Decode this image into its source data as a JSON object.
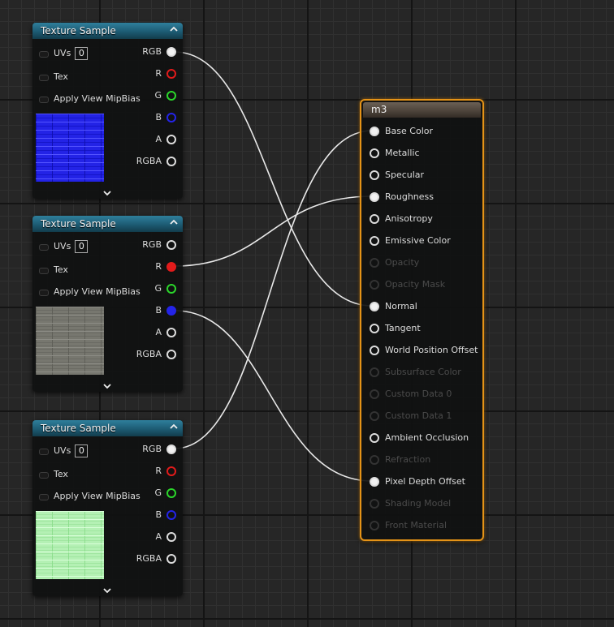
{
  "texture_nodes": [
    {
      "title": "Texture Sample",
      "inputs": {
        "uvs_label": "UVs",
        "uvs_value": "0",
        "tex_label": "Tex",
        "mip_label": "Apply View MipBias"
      },
      "outputs": [
        "RGB",
        "R",
        "G",
        "B",
        "A",
        "RGBA"
      ],
      "connected_output": "RGB",
      "preview": "blue-brick-normal-map"
    },
    {
      "title": "Texture Sample",
      "inputs": {
        "uvs_label": "UVs",
        "uvs_value": "0",
        "tex_label": "Tex",
        "mip_label": "Apply View MipBias"
      },
      "outputs": [
        "RGB",
        "R",
        "G",
        "B",
        "A",
        "RGBA"
      ],
      "connected_outputs": [
        "R",
        "B"
      ],
      "preview": "gray-brick-texture"
    },
    {
      "title": "Texture Sample",
      "inputs": {
        "uvs_label": "UVs",
        "uvs_value": "0",
        "tex_label": "Tex",
        "mip_label": "Apply View MipBias"
      },
      "outputs": [
        "RGB",
        "R",
        "G",
        "B",
        "A",
        "RGBA"
      ],
      "connected_output": "RGB",
      "preview": "green-brick-texture"
    }
  ],
  "material_node": {
    "title": "m3",
    "pins": [
      {
        "label": "Base Color",
        "enabled": true,
        "connected": true
      },
      {
        "label": "Metallic",
        "enabled": true,
        "connected": false
      },
      {
        "label": "Specular",
        "enabled": true,
        "connected": false
      },
      {
        "label": "Roughness",
        "enabled": true,
        "connected": true
      },
      {
        "label": "Anisotropy",
        "enabled": true,
        "connected": false
      },
      {
        "label": "Emissive Color",
        "enabled": true,
        "connected": false
      },
      {
        "label": "Opacity",
        "enabled": false,
        "connected": false
      },
      {
        "label": "Opacity Mask",
        "enabled": false,
        "connected": false
      },
      {
        "label": "Normal",
        "enabled": true,
        "connected": true
      },
      {
        "label": "Tangent",
        "enabled": true,
        "connected": false
      },
      {
        "label": "World Position Offset",
        "enabled": true,
        "connected": false
      },
      {
        "label": "Subsurface Color",
        "enabled": false,
        "connected": false
      },
      {
        "label": "Custom Data 0",
        "enabled": false,
        "connected": false
      },
      {
        "label": "Custom Data 1",
        "enabled": false,
        "connected": false
      },
      {
        "label": "Ambient Occlusion",
        "enabled": true,
        "connected": false
      },
      {
        "label": "Refraction",
        "enabled": false,
        "connected": false
      },
      {
        "label": "Pixel Depth Offset",
        "enabled": true,
        "connected": true
      },
      {
        "label": "Shading Model",
        "enabled": false,
        "connected": false
      },
      {
        "label": "Front Material",
        "enabled": false,
        "connected": false
      }
    ]
  },
  "colors": {
    "pin_red": "#e21b1b",
    "pin_green": "#2bd62b",
    "pin_blue": "#2424e8",
    "material_border": "#e59317",
    "texture_header": "#1d5b73"
  }
}
